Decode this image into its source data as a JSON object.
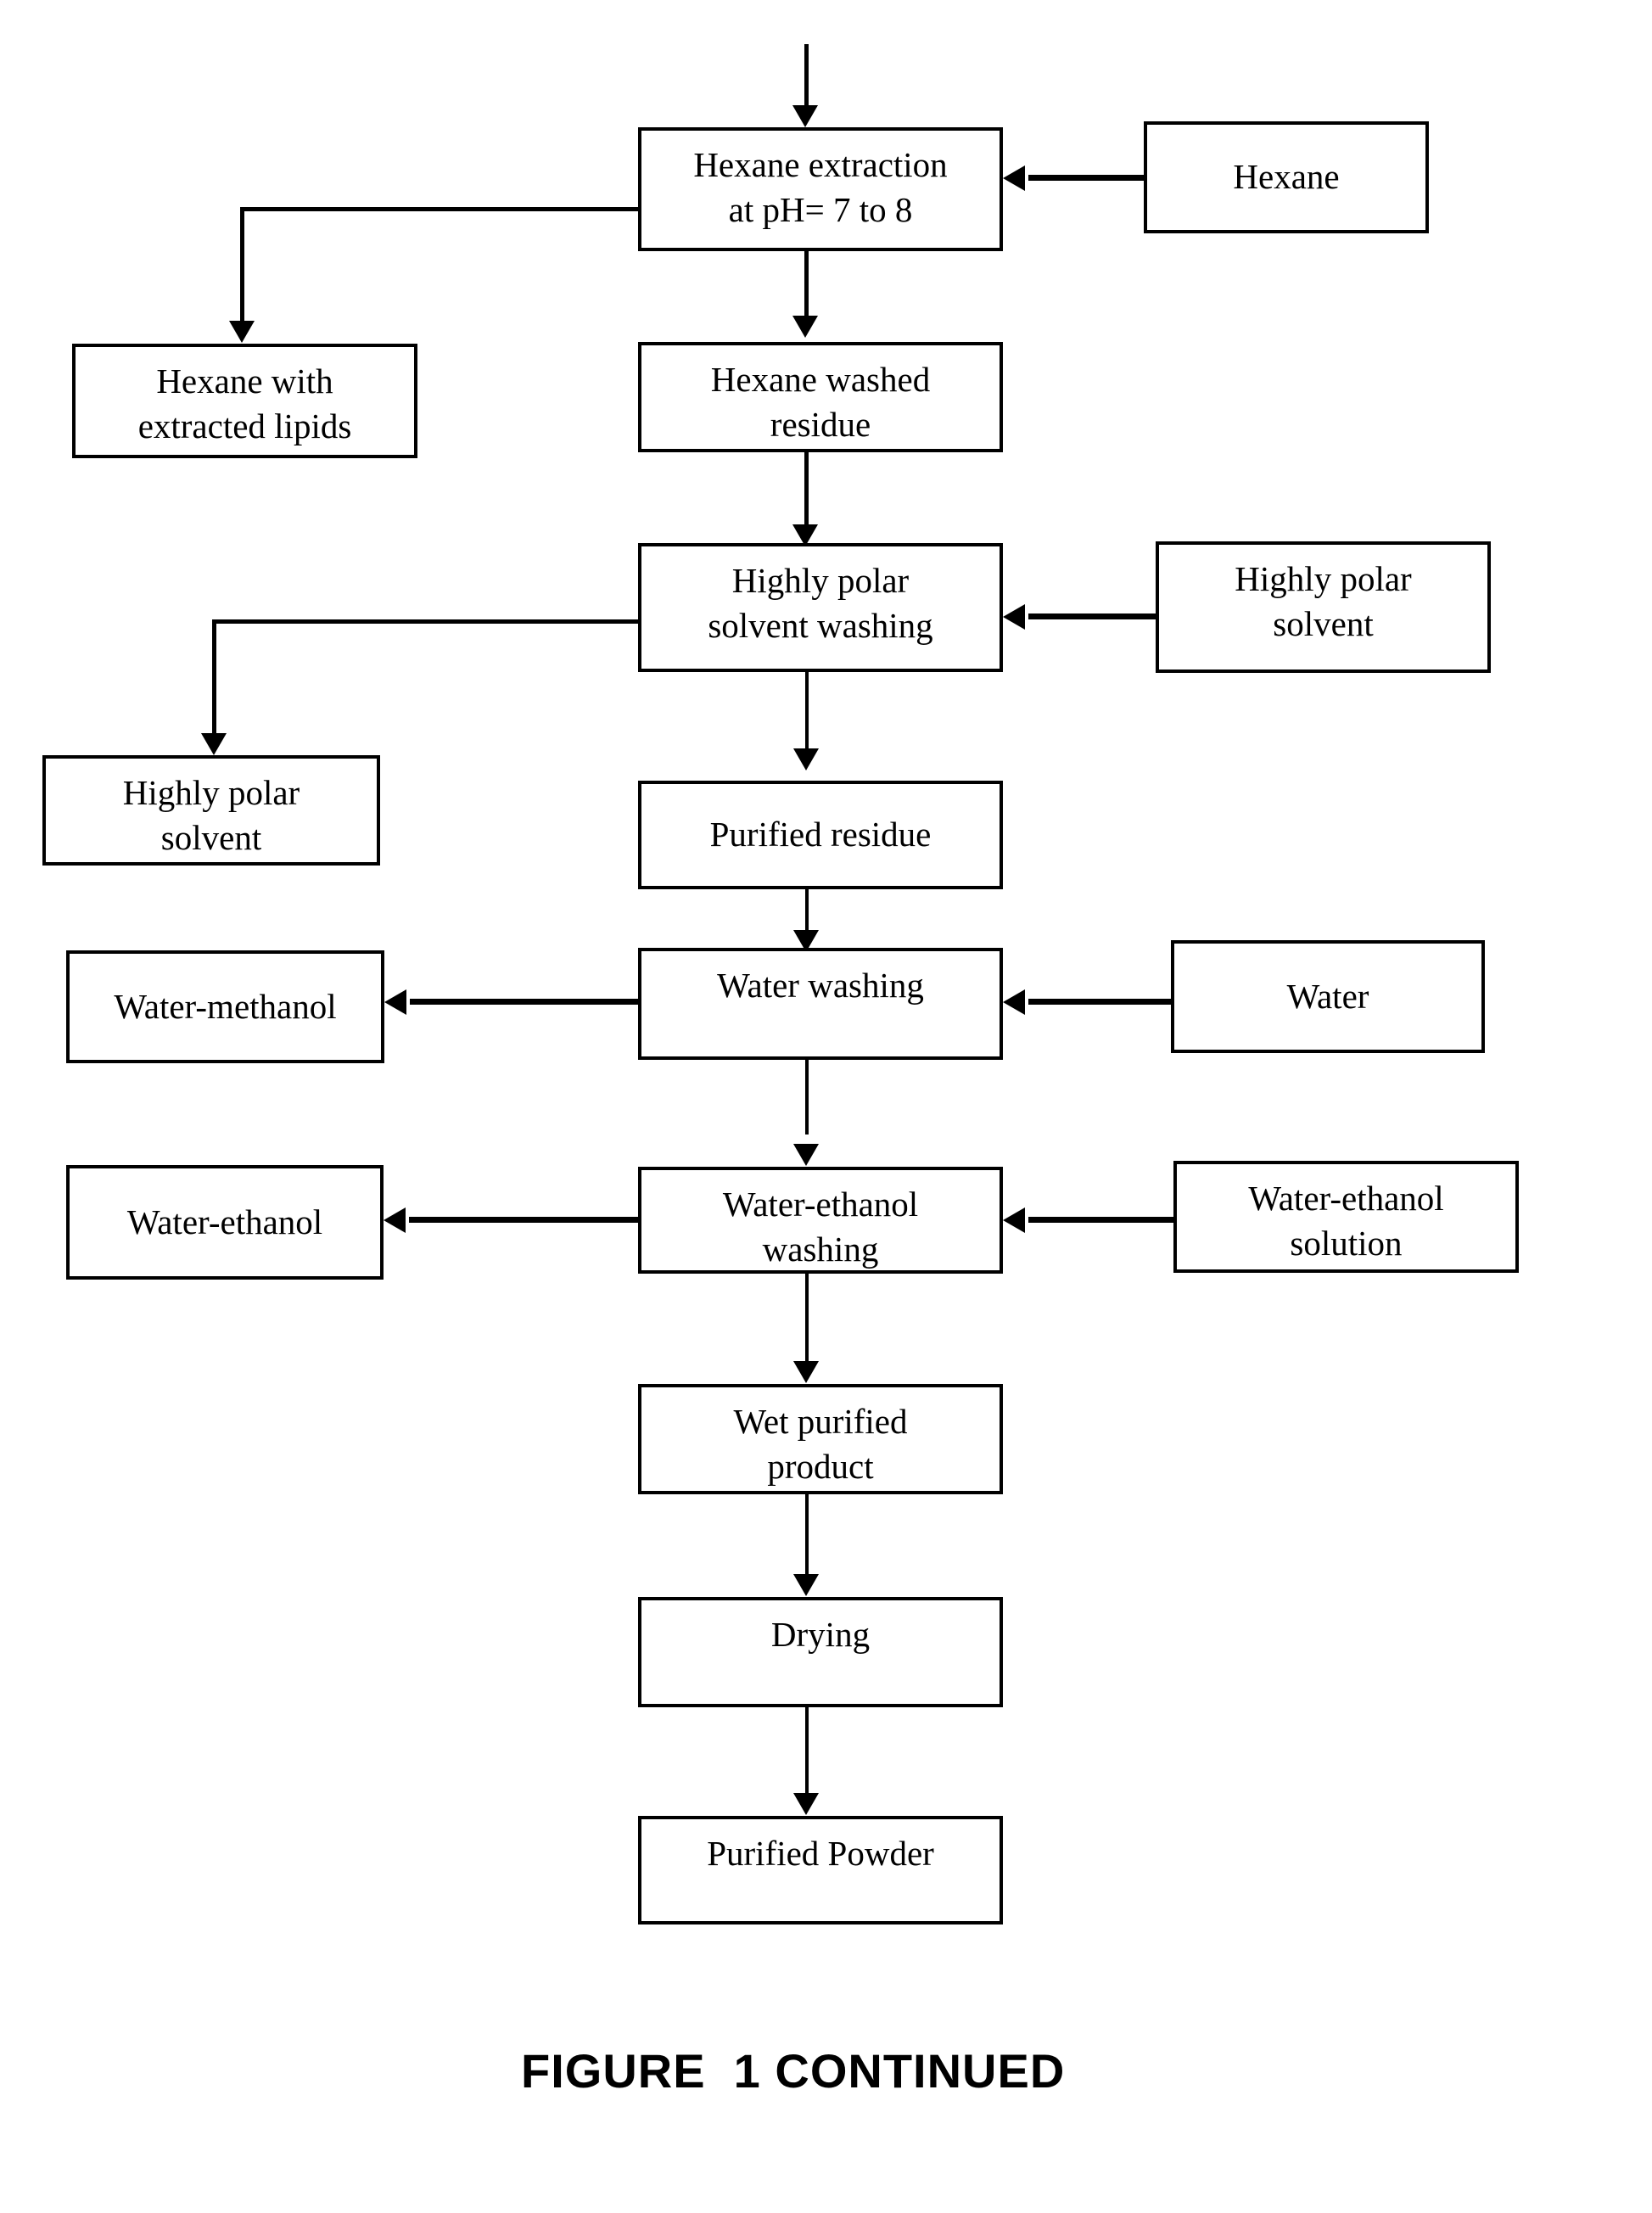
{
  "figure": {
    "caption": "FIGURE  1 CONTINUED",
    "type": "process-flow-diagram"
  },
  "nodes": {
    "hexane_extraction": {
      "label": "Hexane extraction\nat pH= 7 to 8"
    },
    "hexane_reagent": {
      "label": "Hexane"
    },
    "hexane_with_lipids": {
      "label": "Hexane with\nextracted lipids"
    },
    "hexane_washed_residue": {
      "label": "Hexane washed\nresidue"
    },
    "polar_solvent_washing": {
      "label": "Highly polar\nsolvent washing"
    },
    "polar_solvent_reagent": {
      "label": "Highly polar\nsolvent"
    },
    "polar_solvent_waste": {
      "label": "Highly polar\nsolvent"
    },
    "purified_residue": {
      "label": "Purified residue"
    },
    "water_washing": {
      "label": "Water washing"
    },
    "water_reagent": {
      "label": "Water"
    },
    "water_methanol_waste": {
      "label": "Water-methanol"
    },
    "water_ethanol_washing": {
      "label": "Water-ethanol\nwashing"
    },
    "water_ethanol_reagent": {
      "label": "Water-ethanol\nsolution"
    },
    "water_ethanol_waste": {
      "label": "Water-ethanol"
    },
    "wet_purified_product": {
      "label": "Wet purified\nproduct"
    },
    "drying": {
      "label": "Drying"
    },
    "purified_powder": {
      "label": "Purified Powder"
    }
  },
  "edges": [
    {
      "from": "(continued from previous page)",
      "to": "hexane_extraction",
      "direction": "down"
    },
    {
      "from": "hexane_reagent",
      "to": "hexane_extraction",
      "direction": "left"
    },
    {
      "from": "hexane_extraction",
      "to": "hexane_with_lipids",
      "direction": "left-then-down"
    },
    {
      "from": "hexane_extraction",
      "to": "hexane_washed_residue",
      "direction": "down"
    },
    {
      "from": "hexane_washed_residue",
      "to": "polar_solvent_washing",
      "direction": "down"
    },
    {
      "from": "polar_solvent_reagent",
      "to": "polar_solvent_washing",
      "direction": "left"
    },
    {
      "from": "polar_solvent_washing",
      "to": "polar_solvent_waste",
      "direction": "left-then-down"
    },
    {
      "from": "polar_solvent_washing",
      "to": "purified_residue",
      "direction": "down"
    },
    {
      "from": "purified_residue",
      "to": "water_washing",
      "direction": "down"
    },
    {
      "from": "water_reagent",
      "to": "water_washing",
      "direction": "left"
    },
    {
      "from": "water_washing",
      "to": "water_methanol_waste",
      "direction": "left"
    },
    {
      "from": "water_washing",
      "to": "water_ethanol_washing",
      "direction": "down"
    },
    {
      "from": "water_ethanol_reagent",
      "to": "water_ethanol_washing",
      "direction": "left"
    },
    {
      "from": "water_ethanol_washing",
      "to": "water_ethanol_waste",
      "direction": "left"
    },
    {
      "from": "water_ethanol_washing",
      "to": "wet_purified_product",
      "direction": "down"
    },
    {
      "from": "wet_purified_product",
      "to": "drying",
      "direction": "down"
    },
    {
      "from": "drying",
      "to": "purified_powder",
      "direction": "down"
    }
  ],
  "colors": {
    "stroke": "#000000",
    "background": "#ffffff",
    "text": "#000000"
  }
}
